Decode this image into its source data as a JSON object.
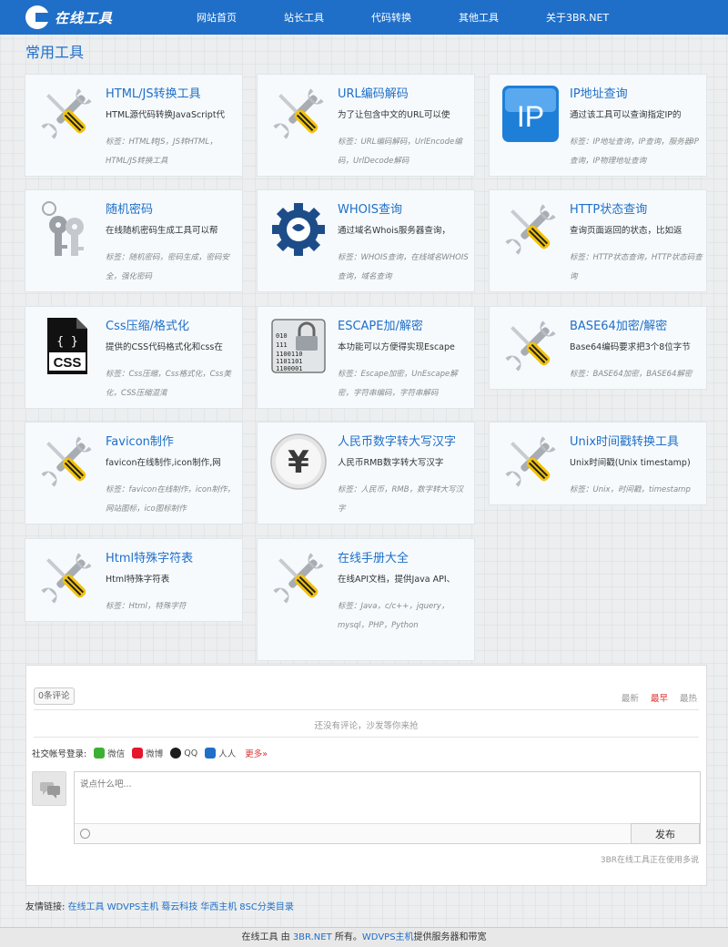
{
  "logo": {
    "text": "在线工具"
  },
  "nav": [
    "网站首页",
    "站长工具",
    "代码转换",
    "其他工具",
    "关于3BR.NET"
  ],
  "section_title": "常用工具",
  "tools": [
    {
      "title": "HTML/JS转换工具",
      "desc": "HTML源代码转换JavaScript代",
      "tags": "标签：HTML转JS，JS转HTML，HTML/JS转换工具",
      "icon": "wrench-screwdriver-icon"
    },
    {
      "title": "URL编码解码",
      "desc": "为了让包含中文的URL可以使",
      "tags": "标签：URL编码解码，UrlEncode编码，UrlDecode解码",
      "icon": "wrench-screwdriver-icon"
    },
    {
      "title": "IP地址查询",
      "desc": "通过该工具可以查询指定IP的",
      "tags": "标签：IP地址查询，IP查询，服务器IP查询，IP物理地址查询",
      "icon": "ip-icon"
    },
    {
      "title": "随机密码",
      "desc": "在线随机密码生成工具可以帮",
      "tags": "标签：随机密码，密码生成，密码安全，强化密码",
      "icon": "keys-icon"
    },
    {
      "title": "WHOIS查询",
      "desc": "通过域名Whois服务器查询，",
      "tags": "标签：WHOIS查询，在线域名WHOIS查询，域名查询",
      "icon": "gear-globe-icon"
    },
    {
      "title": "HTTP状态查询",
      "desc": "查询页面返回的状态，比如返",
      "tags": "标签：HTTP状态查询，HTTP状态码查询",
      "icon": "wrench-screwdriver-icon"
    },
    {
      "title": "Css压缩/格式化",
      "desc": "提供的CSS代码格式化和css在",
      "tags": "标签：Css压缩，Css格式化，Css美化，CSS压缩混淆",
      "icon": "css-file-icon"
    },
    {
      "title": "ESCAPE加/解密",
      "desc": "本功能可以方便得实现Escape",
      "tags": "标签：Escape加密，UnEscape解密，字符串编码，字符串解码",
      "icon": "binary-lock-icon"
    },
    {
      "title": "BASE64加密/解密",
      "desc": "Base64编码要求把3个8位字节",
      "tags": "标签：BASE64加密，BASE64解密",
      "icon": "wrench-screwdriver-icon"
    },
    {
      "title": "Favicon制作",
      "desc": "favicon在线制作,icon制作,网",
      "tags": "标签：favicon在线制作，icon制作，网站图标，ico图标制作",
      "icon": "wrench-screwdriver-icon"
    },
    {
      "title": "人民币数字转大写汉字",
      "desc": "人民币RMB数字转大写汉字",
      "tags": "标签：人民币，RMB，数字转大写汉字",
      "icon": "yuan-coin-icon"
    },
    {
      "title": "Unix时间戳转换工具",
      "desc": "Unix时间戳(Unix timestamp)",
      "tags": "标签：Unix，时间戳，timestamp",
      "icon": "wrench-screwdriver-icon"
    },
    {
      "title": "Html特殊字符表",
      "desc": "Html特殊字符表",
      "tags": "标签：Html，特殊字符",
      "icon": "wrench-screwdriver-icon"
    },
    {
      "title": "在线手册大全",
      "desc": "在线API文档，提供Java API、",
      "tags": "标签：Java，c/c++，jquery，mysql，PHP，Python",
      "icon": "wrench-screwdriver-icon"
    }
  ],
  "comments": {
    "count": "0条评论",
    "sort": [
      "最新",
      "最早",
      "最热"
    ],
    "empty": "还没有评论，沙发等你来抢",
    "social_label": "社交帐号登录:",
    "social": [
      {
        "name": "微信",
        "color": "#3cb034"
      },
      {
        "name": "微博",
        "color": "#e6162d"
      },
      {
        "name": "QQ",
        "color": "#1d1d1d"
      },
      {
        "name": "人人",
        "color": "#1f6fc8"
      }
    ],
    "more": "更多»",
    "placeholder": "说点什么吧...",
    "publish": "发布",
    "powered": "3BR在线工具正在使用多说"
  },
  "friends": {
    "label": "友情链接:",
    "links": [
      "在线工具",
      "WDVPS主机",
      "蓦云科技",
      "华西主机",
      "8SC分类目录"
    ]
  },
  "footer": {
    "t1": "在线工具 由 ",
    "l1": "3BR.NET",
    "t2": " 所有。",
    "l2": "WDVPS主机",
    "t3": "提供服务器和带宽"
  }
}
